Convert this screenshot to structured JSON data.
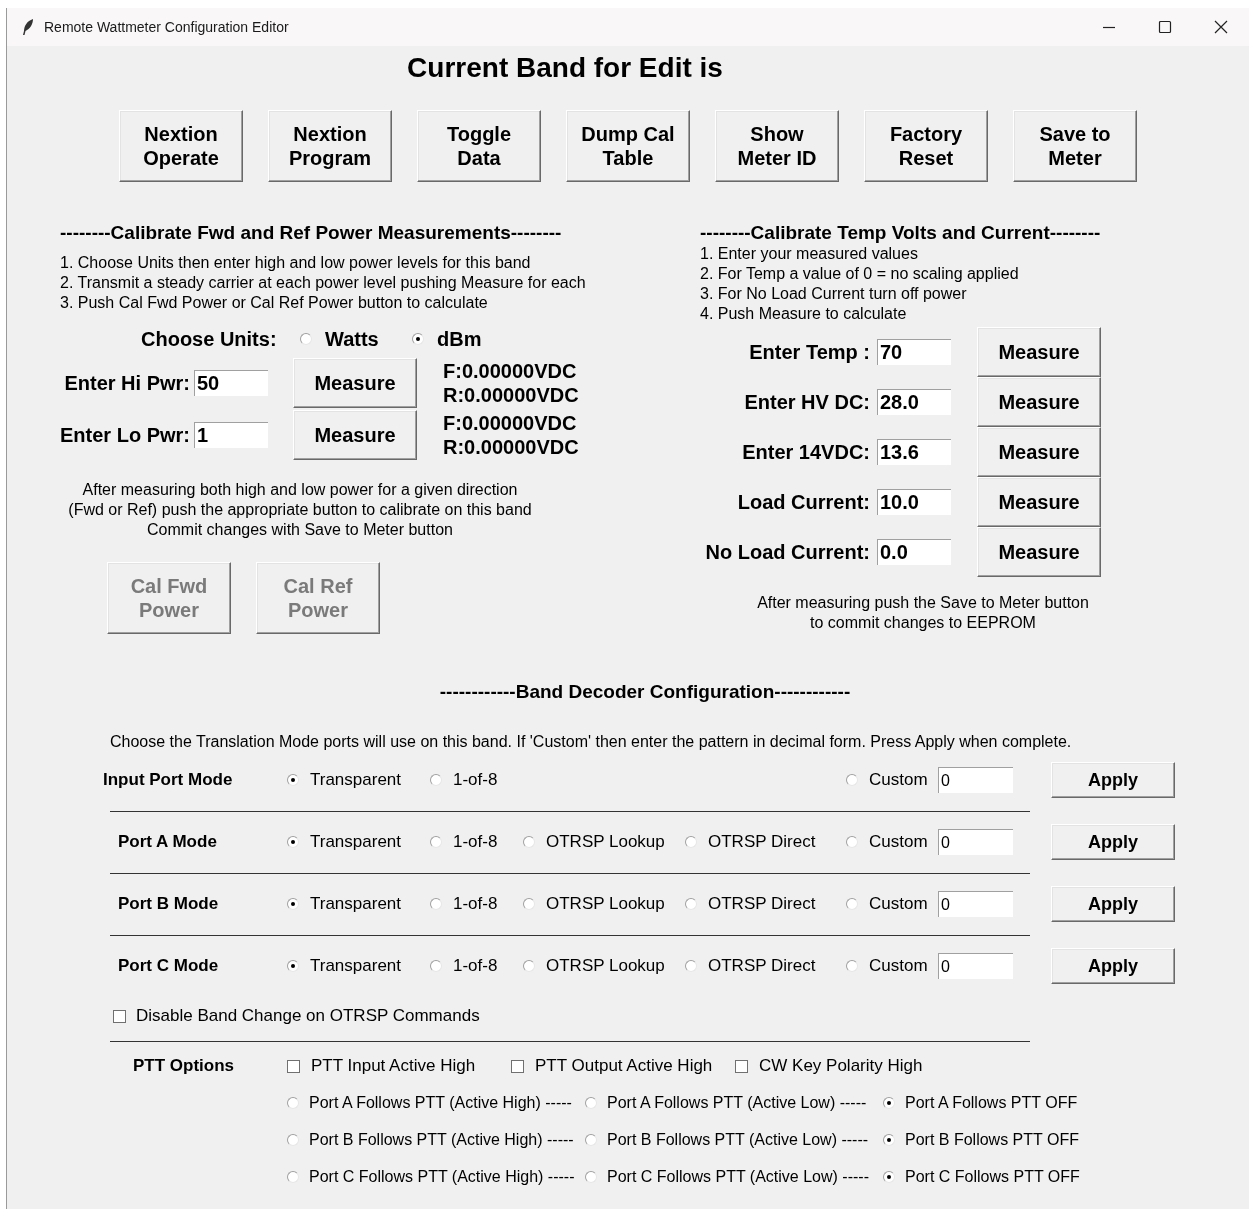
{
  "window": {
    "title": "Remote Wattmeter Configuration Editor"
  },
  "heading": "Current Band for Edit is",
  "toolbar": [
    {
      "label": "Nextion\nOperate"
    },
    {
      "label": "Nextion\nProgram"
    },
    {
      "label": "Toggle\nData"
    },
    {
      "label": "Dump Cal\nTable"
    },
    {
      "label": "Show\nMeter ID"
    },
    {
      "label": "Factory\nReset"
    },
    {
      "label": "Save to\nMeter"
    }
  ],
  "power_calibration": {
    "heading": "--------Calibrate Fwd and Ref Power Measurements--------",
    "instructions": [
      "1. Choose Units then enter high and low power levels for this band",
      "2. Transmit a steady carrier at each power level pushing Measure for each",
      "3. Push Cal Fwd Power or Cal Ref Power button to calculate"
    ],
    "units": {
      "label": "Choose Units:",
      "options": [
        {
          "label": "Watts",
          "selected": false
        },
        {
          "label": "dBm",
          "selected": true
        }
      ]
    },
    "rows": [
      {
        "label": "Enter Hi Pwr:",
        "value": "50",
        "button": "Measure",
        "readings": [
          "F:0.00000VDC",
          "R:0.00000VDC"
        ]
      },
      {
        "label": "Enter Lo Pwr:",
        "value": "1",
        "button": "Measure",
        "readings": [
          "F:0.00000VDC",
          "R:0.00000VDC"
        ]
      }
    ],
    "note": [
      "After measuring both high and low power for a given direction",
      "(Fwd or Ref) push the appropriate button to calibrate on this band",
      "Commit changes with Save to Meter button"
    ],
    "buttons": [
      {
        "label": "Cal Fwd\nPower",
        "disabled": true
      },
      {
        "label": "Cal Ref\nPower",
        "disabled": true
      }
    ]
  },
  "temp_calibration": {
    "heading": "--------Calibrate Temp Volts and Current--------",
    "instructions": [
      "1. Enter your measured values",
      "2. For Temp a value of 0 = no scaling applied",
      "3. For No Load Current turn off power",
      "4. Push Measure to calculate"
    ],
    "rows": [
      {
        "label": "Enter Temp :",
        "value": "70",
        "button": "Measure"
      },
      {
        "label": "Enter HV DC:",
        "value": "28.0",
        "button": "Measure"
      },
      {
        "label": "Enter 14VDC:",
        "value": "13.6",
        "button": "Measure"
      },
      {
        "label": "Load Current:",
        "value": "10.0",
        "button": "Measure"
      },
      {
        "label": "No Load Current:",
        "value": "0.0",
        "button": "Measure"
      }
    ],
    "note": [
      "After measuring push the Save to Meter button",
      "to commit changes to EEPROM"
    ]
  },
  "band_decoder": {
    "heading": "------------Band Decoder Configuration------------",
    "description": "Choose the Translation Mode ports will use on this band.  If 'Custom' then enter the pattern in decimal form.  Press Apply when complete.",
    "ports": [
      {
        "kind": "input",
        "label": "Input Port Mode",
        "options": [
          {
            "kind": "transparent",
            "label": "Transparent",
            "selected": true
          },
          {
            "kind": "one_of_8",
            "label": "1-of-8",
            "selected": false
          },
          {
            "kind": "custom",
            "label": "Custom",
            "selected": false
          }
        ],
        "custom_value": "0",
        "button": "Apply"
      },
      {
        "kind": "port",
        "label": "Port A Mode",
        "options": [
          {
            "kind": "transparent",
            "label": "Transparent",
            "selected": true
          },
          {
            "kind": "one_of_8",
            "label": "1-of-8",
            "selected": false
          },
          {
            "kind": "otrsp_lookup",
            "label": "OTRSP Lookup",
            "selected": false
          },
          {
            "kind": "otrsp_direct",
            "label": "OTRSP Direct",
            "selected": false
          },
          {
            "kind": "custom",
            "label": "Custom",
            "selected": false
          }
        ],
        "custom_value": "0",
        "button": "Apply"
      },
      {
        "kind": "port",
        "label": "Port B Mode",
        "options": [
          {
            "kind": "transparent",
            "label": "Transparent",
            "selected": true
          },
          {
            "kind": "one_of_8",
            "label": "1-of-8",
            "selected": false
          },
          {
            "kind": "otrsp_lookup",
            "label": "OTRSP Lookup",
            "selected": false
          },
          {
            "kind": "otrsp_direct",
            "label": "OTRSP Direct",
            "selected": false
          },
          {
            "kind": "custom",
            "label": "Custom",
            "selected": false
          }
        ],
        "custom_value": "0",
        "button": "Apply"
      },
      {
        "kind": "port",
        "label": "Port C Mode",
        "options": [
          {
            "kind": "transparent",
            "label": "Transparent",
            "selected": true
          },
          {
            "kind": "one_of_8",
            "label": "1-of-8",
            "selected": false
          },
          {
            "kind": "otrsp_lookup",
            "label": "OTRSP Lookup",
            "selected": false
          },
          {
            "kind": "otrsp_direct",
            "label": "OTRSP Direct",
            "selected": false
          },
          {
            "kind": "custom",
            "label": "Custom",
            "selected": false
          }
        ],
        "custom_value": "0",
        "button": "Apply"
      }
    ],
    "disable_band_change": {
      "label": "Disable Band Change on OTRSP Commands",
      "checked": false
    },
    "ptt": {
      "label": "PTT Options",
      "checkboxes": [
        {
          "label": "PTT Input Active High",
          "checked": false
        },
        {
          "label": "PTT Output Active High",
          "checked": false
        },
        {
          "label": "CW Key Polarity High",
          "checked": false
        }
      ],
      "follow_rows": [
        [
          {
            "label": "Port A Follows PTT (Active High) -----",
            "selected": false
          },
          {
            "label": "Port A Follows PTT (Active Low) -----",
            "selected": false
          },
          {
            "label": "Port A Follows PTT OFF",
            "selected": true
          }
        ],
        [
          {
            "label": "Port B Follows PTT (Active High) -----",
            "selected": false
          },
          {
            "label": "Port B Follows PTT (Active Low) -----",
            "selected": false
          },
          {
            "label": "Port B Follows PTT OFF",
            "selected": true
          }
        ],
        [
          {
            "label": "Port C Follows PTT (Active High) -----",
            "selected": false
          },
          {
            "label": "Port C Follows PTT (Active Low) -----",
            "selected": false
          },
          {
            "label": "Port C Follows PTT OFF",
            "selected": true
          }
        ]
      ]
    }
  }
}
